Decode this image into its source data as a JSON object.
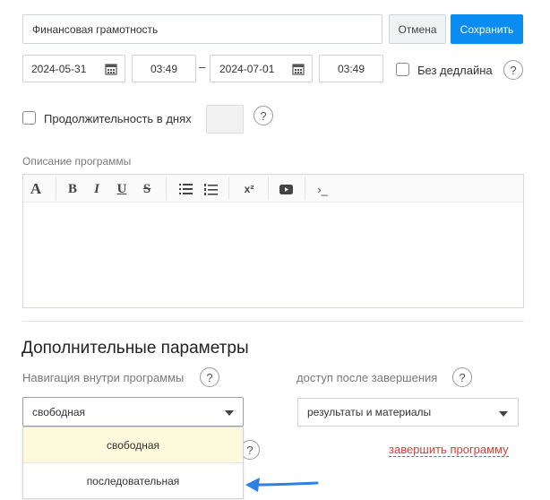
{
  "program": {
    "title_value": "Финансовая грамотность"
  },
  "buttons": {
    "cancel": "Отмена",
    "save": "Сохранить"
  },
  "dates": {
    "start_date": "2024-05-31",
    "start_time": "03:49",
    "separator": "–",
    "end_date": "2024-07-01",
    "end_time": "03:49",
    "no_deadline_label": "Без дедлайна"
  },
  "duration": {
    "label": "Продолжительность в днях",
    "value": ""
  },
  "description": {
    "label": "Описание программы",
    "toolbar": {
      "font": "A",
      "bold": "B",
      "italic": "I",
      "underline": "U",
      "strike": "S",
      "superscript": "x²",
      "code": "›_"
    },
    "content": ""
  },
  "additional": {
    "heading": "Дополнительные параметры",
    "navigation": {
      "label": "Навигация внутри программы",
      "selected": "свободная",
      "options": [
        "свободная",
        "последовательная"
      ]
    },
    "access": {
      "label": "доступ после завершения",
      "selected": "результаты и материалы"
    },
    "finish_link": "завершить программу"
  },
  "help_glyph": "?",
  "colors": {
    "primary": "#0a8cf0",
    "danger": "#e53935",
    "option_highlight": "#fdf9dc",
    "arrow": "#2f7fe0"
  }
}
